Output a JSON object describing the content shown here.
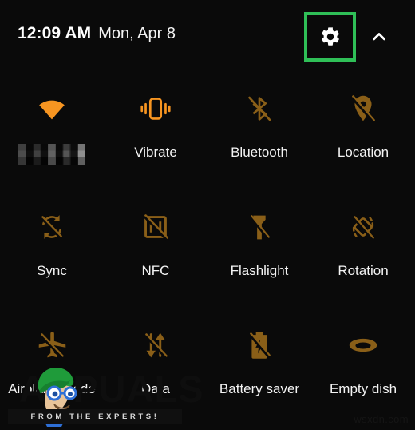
{
  "header": {
    "time": "12:09 AM",
    "date": "Mon, Apr 8",
    "settings_icon": "gear-icon",
    "collapse_icon": "chevron-up-icon",
    "highlight_color": "#2fbf57"
  },
  "colors": {
    "background": "#0a0a0a",
    "icon_on": "#f79521",
    "icon_off": "#8a5f18",
    "label": "#f4f4f4",
    "highlight": "#2fbf57"
  },
  "tiles": [
    {
      "label": "",
      "icon": "wifi-icon",
      "state": "on",
      "label_redacted": true
    },
    {
      "label": "Vibrate",
      "icon": "vibrate-icon",
      "state": "on",
      "label_redacted": false
    },
    {
      "label": "Bluetooth",
      "icon": "bluetooth-off-icon",
      "state": "off",
      "label_redacted": false
    },
    {
      "label": "Location",
      "icon": "location-off-icon",
      "state": "off",
      "label_redacted": false
    },
    {
      "label": "Sync",
      "icon": "sync-off-icon",
      "state": "off",
      "label_redacted": false
    },
    {
      "label": "NFC",
      "icon": "nfc-off-icon",
      "state": "off",
      "label_redacted": false
    },
    {
      "label": "Flashlight",
      "icon": "flashlight-off-icon",
      "state": "off",
      "label_redacted": false
    },
    {
      "label": "Rotation",
      "icon": "rotation-off-icon",
      "state": "off",
      "label_redacted": false
    },
    {
      "label": "Airplane mode",
      "icon": "airplane-off-icon",
      "state": "off",
      "label_redacted": false
    },
    {
      "label": "Data",
      "icon": "data-off-icon",
      "state": "off",
      "label_redacted": false
    },
    {
      "label": "Battery saver",
      "icon": "battery-saver-off-icon",
      "state": "off",
      "label_redacted": false
    },
    {
      "label": "Empty dish",
      "icon": "dish-icon",
      "state": "off",
      "label_redacted": false
    }
  ],
  "watermarks": {
    "brand": "APPUALS",
    "tagline": "FROM THE EXPERTS!",
    "corner": "wsxdn.com"
  }
}
